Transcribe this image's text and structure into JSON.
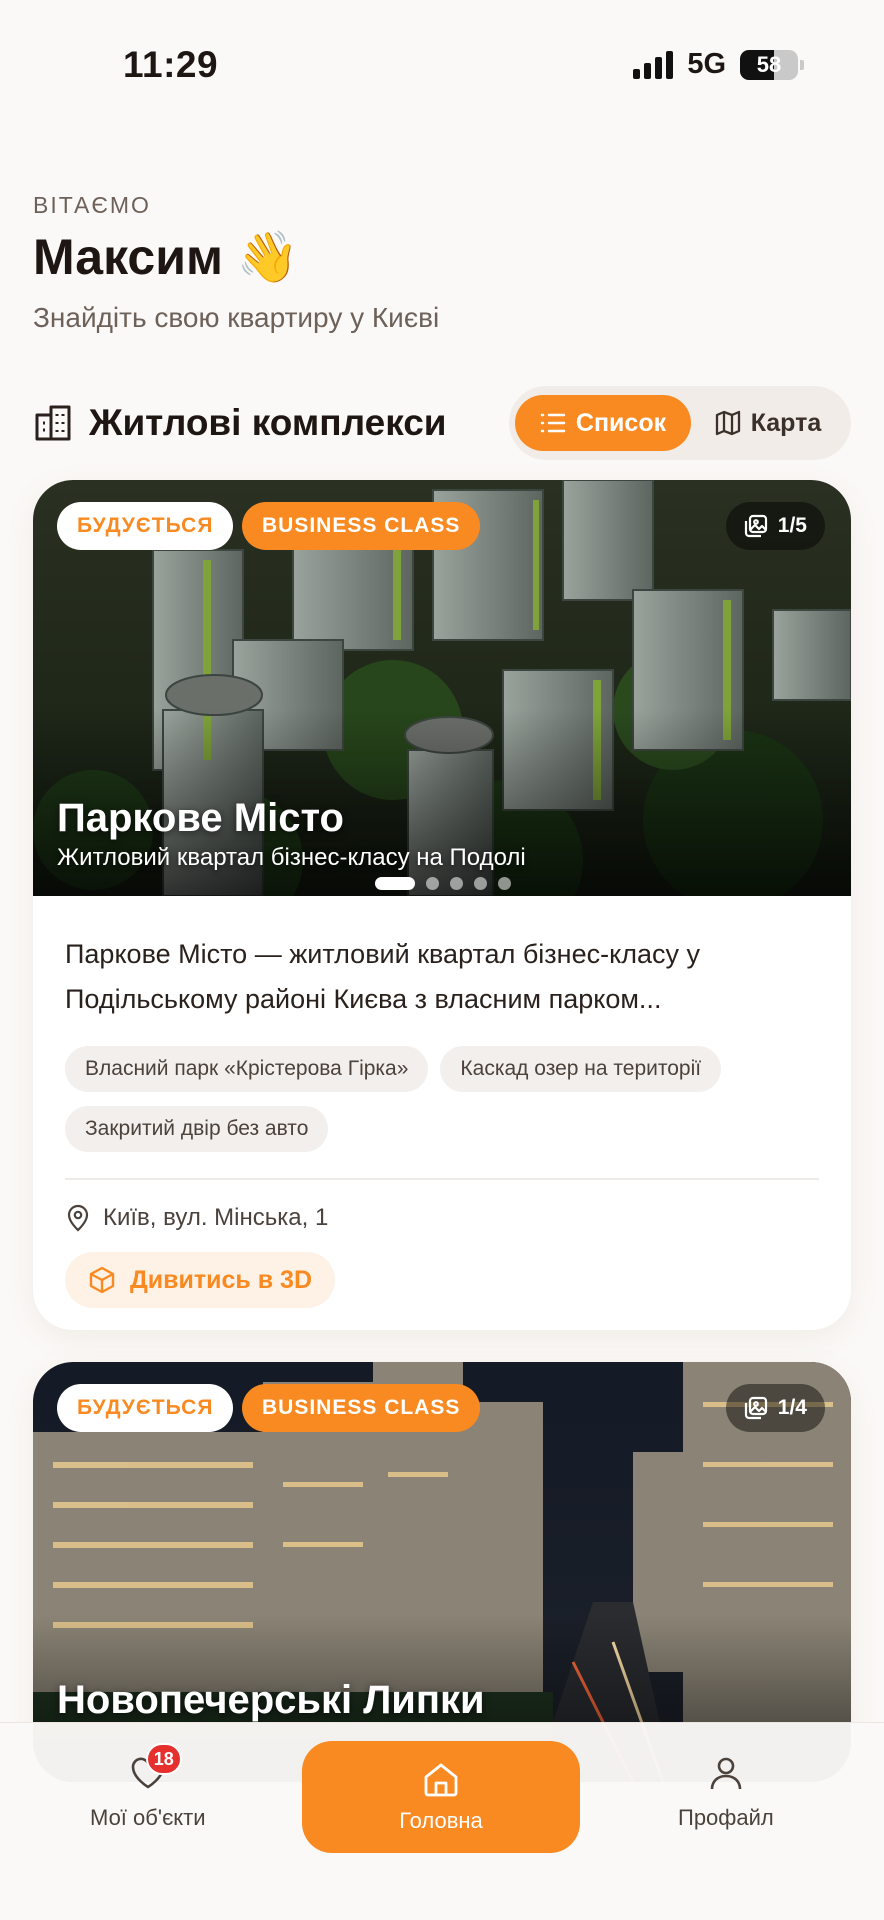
{
  "status_bar": {
    "time": "11:29",
    "network": "5G",
    "battery": "58"
  },
  "greeting": {
    "eyebrow": "ВІТАЄМО",
    "name": "Максим 👋",
    "subtitle": "Знайдіть свою квартиру у Києві"
  },
  "section": {
    "title": "Житлові комплекси",
    "view_toggle": {
      "list_label": "Список",
      "map_label": "Карта",
      "selected": "list"
    }
  },
  "complexes": [
    {
      "status_badge": "БУДУЄТЬСЯ",
      "class_badge": "BUSINESS CLASS",
      "photo_counter": "1/5",
      "title": "Паркове Місто",
      "subtitle": "Житловий квартал бізнес-класу на Подолі",
      "description": "Паркове Місто — житловий квартал бізнес-класу у Подільському районі Києва з власним парком...",
      "features": [
        "Власний парк «Крістерова Гірка»",
        "Каскад озер на території",
        "Закритий двір без авто"
      ],
      "address": "Київ, вул. Мінська, 1",
      "view_3d_label": "Дивитись в 3D",
      "carousel_active_index": 0,
      "carousel_count": 5
    },
    {
      "status_badge": "БУДУЄТЬСЯ",
      "class_badge": "BUSINESS CLASS",
      "photo_counter": "1/4",
      "title": "Новопечерські Липки"
    }
  ],
  "bottom_nav": {
    "favorites_label": "Мої об'єкти",
    "favorites_count": "18",
    "home_label": "Головна",
    "profile_label": "Профайл"
  },
  "colors": {
    "accent": "#f98a22",
    "notification": "#e5302e",
    "background": "#fbf9f7"
  }
}
